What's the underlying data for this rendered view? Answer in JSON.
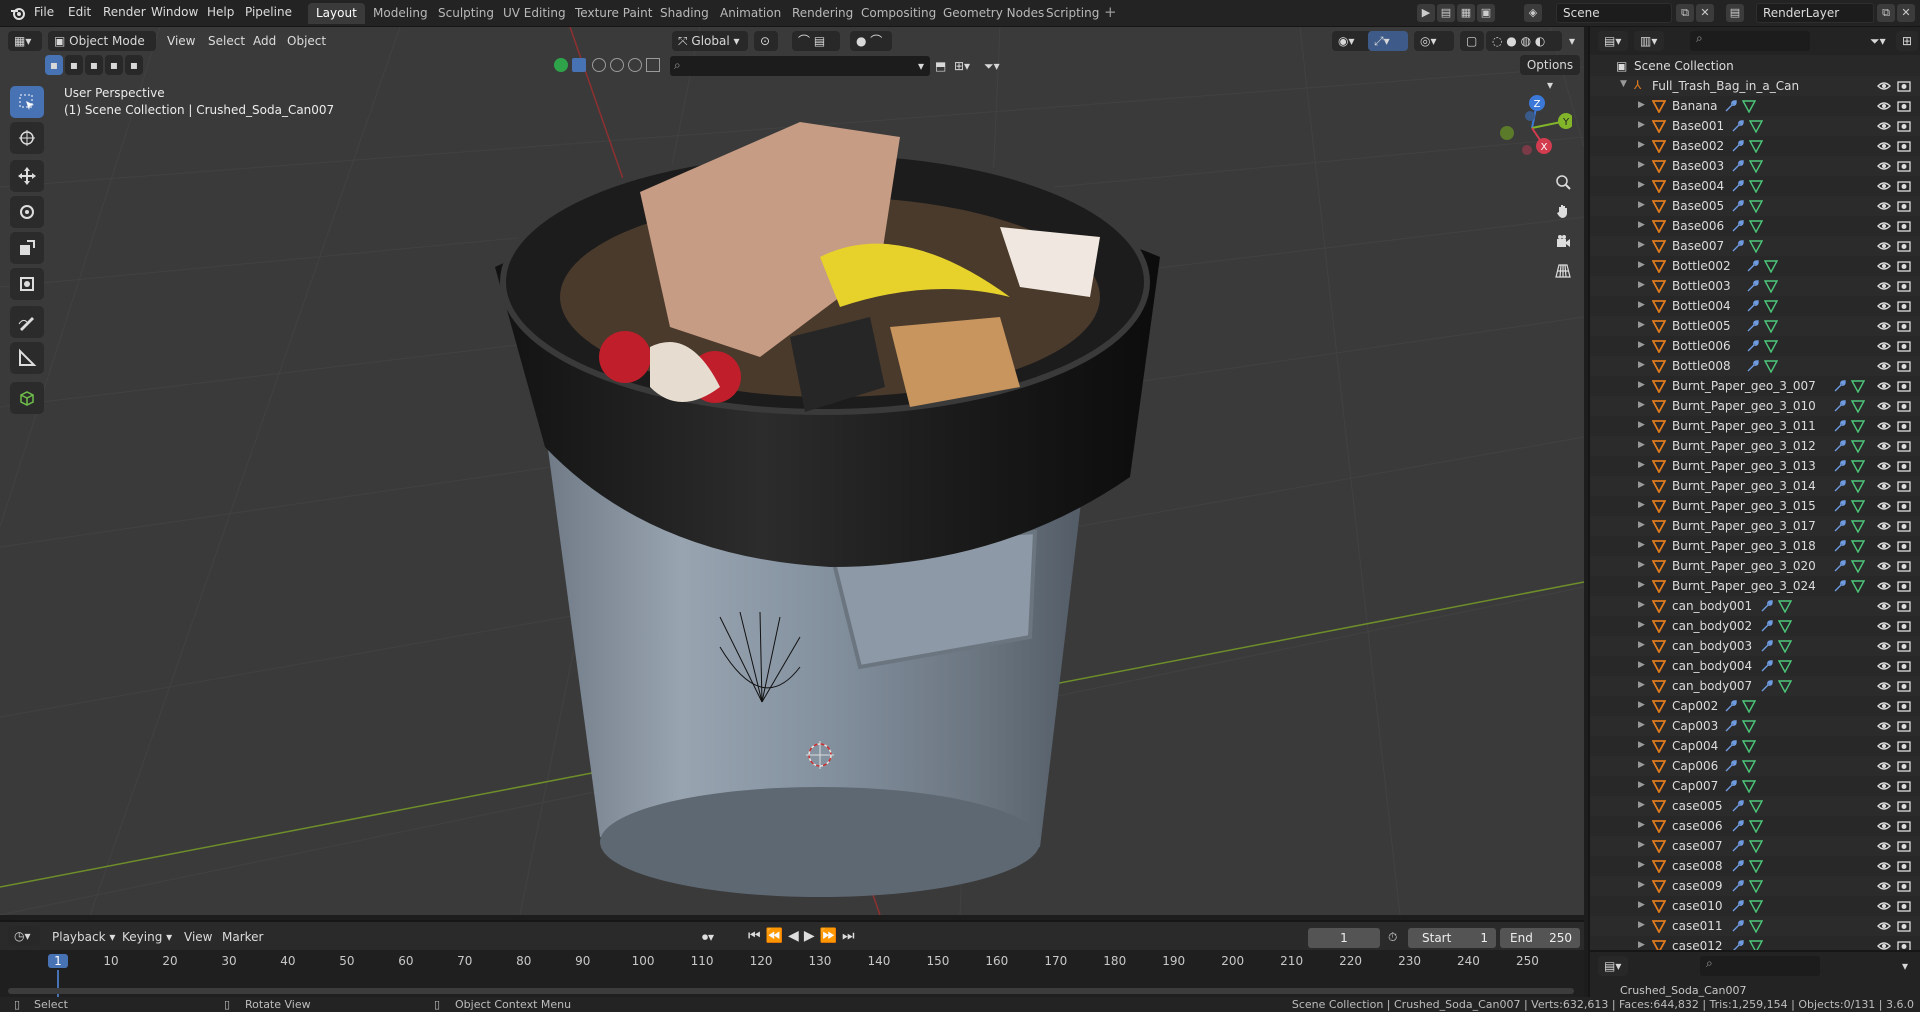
{
  "top_menu": [
    "File",
    "Edit",
    "Render",
    "Window",
    "Help",
    "Pipeline"
  ],
  "workspaces": [
    {
      "label": "Layout",
      "active": true
    },
    {
      "label": "Modeling"
    },
    {
      "label": "Sculpting"
    },
    {
      "label": "UV Editing"
    },
    {
      "label": "Texture Paint"
    },
    {
      "label": "Shading"
    },
    {
      "label": "Animation"
    },
    {
      "label": "Rendering"
    },
    {
      "label": "Compositing"
    },
    {
      "label": "Geometry Nodes"
    },
    {
      "label": "Scripting"
    }
  ],
  "scene_name": "Scene",
  "render_layer": "RenderLayer",
  "viewport": {
    "mode_label": "Object Mode",
    "menus": [
      "View",
      "Select",
      "Add",
      "Object"
    ],
    "transform_orientation": "Global",
    "options_label": "Options",
    "perspective_label": "User Perspective",
    "context_label": "(1) Scene Collection | Crushed_Soda_Can007",
    "gizmo_axes": [
      "X",
      "Y",
      "Z"
    ]
  },
  "outliner": {
    "scene_collection": "Scene Collection",
    "root_collection": "Full_Trash_Bag_in_a_Can",
    "items": [
      "Banana",
      "Base001",
      "Base002",
      "Base003",
      "Base004",
      "Base005",
      "Base006",
      "Base007",
      "Bottle002",
      "Bottle003",
      "Bottle004",
      "Bottle005",
      "Bottle006",
      "Bottle008",
      "Burnt_Paper_geo_3_007",
      "Burnt_Paper_geo_3_010",
      "Burnt_Paper_geo_3_011",
      "Burnt_Paper_geo_3_012",
      "Burnt_Paper_geo_3_013",
      "Burnt_Paper_geo_3_014",
      "Burnt_Paper_geo_3_015",
      "Burnt_Paper_geo_3_017",
      "Burnt_Paper_geo_3_018",
      "Burnt_Paper_geo_3_020",
      "Burnt_Paper_geo_3_024",
      "can_body001",
      "can_body002",
      "can_body003",
      "can_body004",
      "can_body007",
      "Cap002",
      "Cap003",
      "Cap004",
      "Cap006",
      "Cap007",
      "case005",
      "case006",
      "case007",
      "case008",
      "case009",
      "case010",
      "case011",
      "case012"
    ],
    "lower_item": "Crushed_Soda_Can007"
  },
  "timeline": {
    "menus": [
      "Playback",
      "Keying",
      "View",
      "Marker"
    ],
    "current_frame": "1",
    "start_label": "Start",
    "start_value": "1",
    "end_label": "End",
    "end_value": "250",
    "ticks": [
      "1",
      "10",
      "20",
      "30",
      "40",
      "50",
      "60",
      "70",
      "80",
      "90",
      "100",
      "110",
      "120",
      "130",
      "140",
      "150",
      "160",
      "170",
      "180",
      "190",
      "200",
      "210",
      "220",
      "230",
      "240",
      "250"
    ]
  },
  "status": {
    "left": "Select",
    "middle": "Rotate View",
    "right": "Object Context Menu",
    "stats": "Scene Collection | Crushed_Soda_Can007 | Verts:632,613 | Faces:644,832 | Tris:1,259,154 | Objects:0/131 | 3.6.0"
  },
  "colors": {
    "accent": "#4772b3",
    "mesh_icon": "#e07b1e",
    "grid_y": "#6e8e2a",
    "grid_x": "#8e3030"
  }
}
